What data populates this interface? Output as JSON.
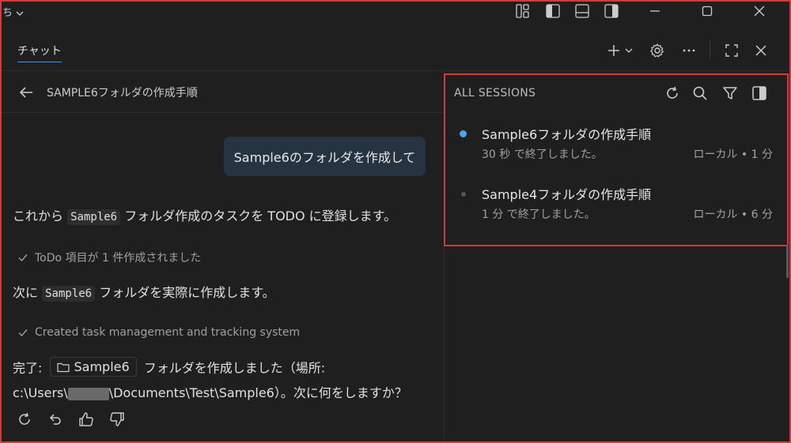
{
  "titlebar": {
    "left_glyph": "ち",
    "icons": [
      "layout-customize-icon",
      "panel-left-icon",
      "panel-bottom-icon",
      "panel-right-icon"
    ],
    "window_controls": [
      "minimize-icon",
      "maximize-icon",
      "close-icon"
    ]
  },
  "chat": {
    "tab_label": "チャット",
    "header_icons": [
      "plus-icon",
      "chevron-down-icon",
      "gear-icon",
      "more-icon",
      "maximize-icon",
      "close-icon"
    ],
    "back_title": "SAMPLE6フォルダの作成手順",
    "user_message": "Sample6のフォルダを作成して",
    "messages": {
      "m1_before": "これから",
      "m1_code": "Sample6",
      "m1_after": "フォルダ作成のタスクを TODO に登録します。",
      "check1": "ToDo 項目が 1 件作成されました",
      "m2_before": "次に",
      "m2_code": "Sample6",
      "m2_after": "フォルダを実際に作成します。",
      "check2": "Created task management and tracking system",
      "m3_before": "完了:",
      "m3_chip": "Sample6",
      "m3_after": "フォルダを作成しました（場所:",
      "m3_path_before": "c:\\Users\\",
      "m3_path_after": "\\Documents\\Test\\Sample6）。次に何をしますか？"
    },
    "action_icons": [
      "retry-icon",
      "undo-icon",
      "thumbs-up-icon",
      "thumbs-down-icon"
    ]
  },
  "sessions": {
    "title": "ALL SESSIONS",
    "toolbar_icons": [
      "refresh-icon",
      "search-icon",
      "filter-icon",
      "toggle-panel-icon"
    ],
    "items": [
      {
        "name": "Sample6フォルダの作成手順",
        "status": "30 秒 で終了しました。",
        "meta": "ローカル • 1 分",
        "dot_color": "#4aa3f0"
      },
      {
        "name": "Sample4フォルダの作成手順",
        "status": "1 分 で終了しました。",
        "meta": "ローカル • 6 分",
        "dot_color": "#555555"
      }
    ]
  },
  "colors": {
    "background": "#1f1f1f",
    "accent": "#3794ff",
    "highlight_border": "#d9383a",
    "bubble": "#263341"
  }
}
